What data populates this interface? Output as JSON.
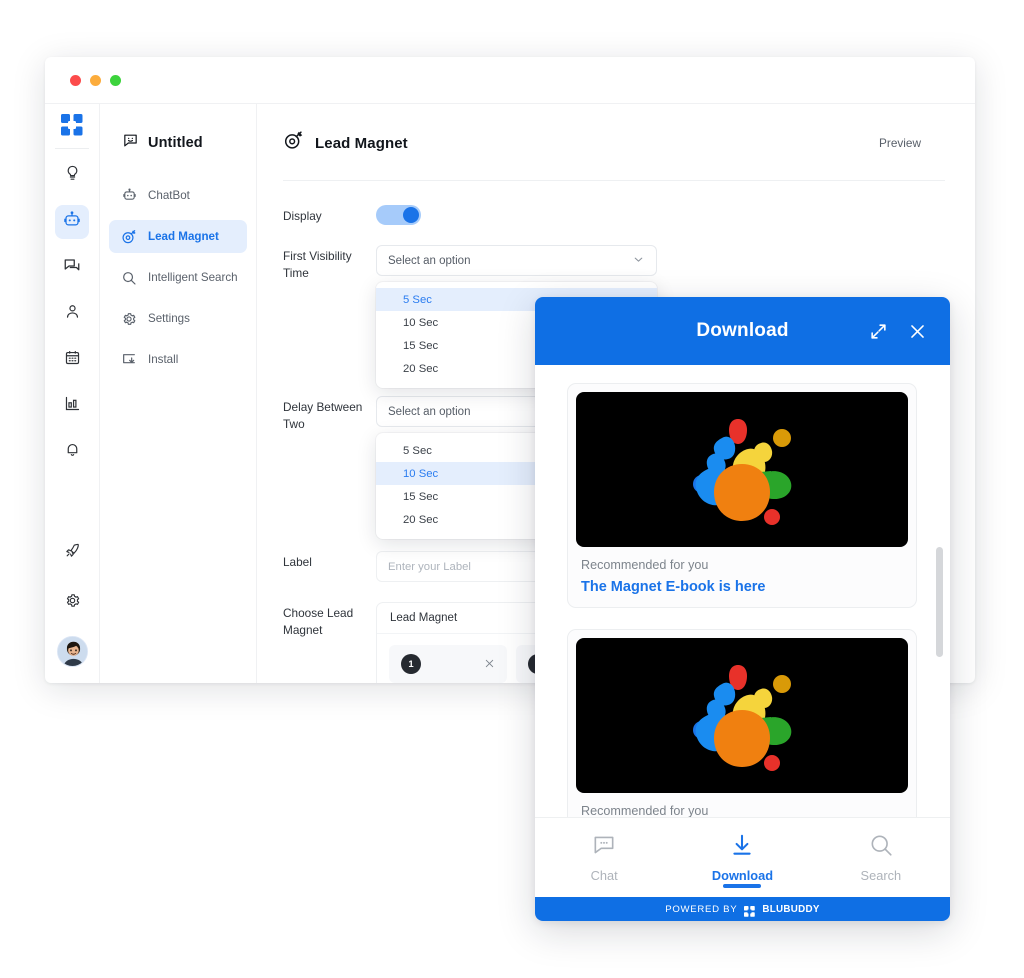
{
  "window": {
    "traffic_lights": [
      "close",
      "minimize",
      "maximize"
    ]
  },
  "rail": {
    "logo_icon": "grid-logo-icon",
    "items": [
      {
        "name": "lightbulb",
        "icon": "lightbulb-icon",
        "active": false
      },
      {
        "name": "chatbot",
        "icon": "robot-icon",
        "active": true
      },
      {
        "name": "conversations",
        "icon": "chat-bubbles-icon",
        "active": false
      },
      {
        "name": "contacts",
        "icon": "person-icon",
        "active": false
      },
      {
        "name": "calendar",
        "icon": "calendar-icon",
        "active": false
      },
      {
        "name": "analytics",
        "icon": "bar-chart-icon",
        "active": false
      },
      {
        "name": "notifications",
        "icon": "bell-icon",
        "active": false
      }
    ],
    "bottom": [
      {
        "name": "upgrade",
        "icon": "rocket-icon"
      },
      {
        "name": "settings",
        "icon": "gear-icon"
      },
      {
        "name": "profile",
        "icon": "avatar"
      }
    ]
  },
  "nav": {
    "title": "Untitled",
    "title_icon": "chat-smiley-icon",
    "items": [
      {
        "label": "ChatBot",
        "icon": "robot-icon",
        "active": false
      },
      {
        "label": "Lead Magnet",
        "icon": "magnet-icon",
        "active": true
      },
      {
        "label": "Intelligent Search",
        "icon": "search-icon",
        "active": false
      },
      {
        "label": "Settings",
        "icon": "gear-icon",
        "active": false
      },
      {
        "label": "Install",
        "icon": "install-icon",
        "active": false
      }
    ]
  },
  "main": {
    "title": "Lead Magnet",
    "title_icon": "magnet-icon",
    "preview_label": "Preview",
    "fields": {
      "display": {
        "label": "Display",
        "toggle_on": true
      },
      "first_visibility": {
        "label": "First Visibility Time",
        "placeholder": "Select an option",
        "value": "",
        "options": [
          "5 Sec",
          "10 Sec",
          "15 Sec",
          "20 Sec"
        ],
        "highlighted": "5 Sec",
        "open": true
      },
      "delay_between_two": {
        "label": "Delay Between Two",
        "placeholder": "Select an option",
        "value": "",
        "options": [
          "5 Sec",
          "10 Sec",
          "15 Sec",
          "20 Sec"
        ],
        "highlighted": "10 Sec",
        "open": true
      },
      "label_field": {
        "label": "Label",
        "placeholder": "Enter your Label",
        "value": ""
      },
      "choose_lead_magnet": {
        "label": "Choose Lead Magnet",
        "box_title": "Lead Magnet",
        "chips": [
          {
            "number": "1",
            "remove_icon": "close-icon"
          },
          {
            "number": "2",
            "remove_icon": "close-icon"
          }
        ]
      }
    }
  },
  "widget": {
    "header": {
      "title": "Download",
      "expand_icon": "expand-arrows-icon",
      "close_icon": "close-icon"
    },
    "cards": [
      {
        "kicker": "Recommended for you",
        "title": "The Magnet E-book is here",
        "thumb": "paint-splash-logo"
      },
      {
        "kicker": "Recommended for you",
        "title": "",
        "thumb": "paint-splash-logo"
      }
    ],
    "tabs": [
      {
        "label": "Chat",
        "icon": "chat-bubble-icon",
        "active": false
      },
      {
        "label": "Download",
        "icon": "download-arrow-icon",
        "active": true
      },
      {
        "label": "Search",
        "icon": "search-icon",
        "active": false
      }
    ],
    "footer": {
      "powered_by": "POWERED BY",
      "brand": "BLUBUDDY",
      "brand_icon": "grid-logo-icon"
    }
  },
  "colors": {
    "accent_blue": "#1a73e8",
    "header_blue": "#0f6fe4",
    "active_bg": "#e4eefd",
    "text_dark": "#12161c",
    "text_muted": "#7d848c",
    "splash": [
      "#e8312a",
      "#1a8cf0",
      "#f5d43c",
      "#f08010",
      "#2aa52a",
      "#d99a08"
    ]
  }
}
